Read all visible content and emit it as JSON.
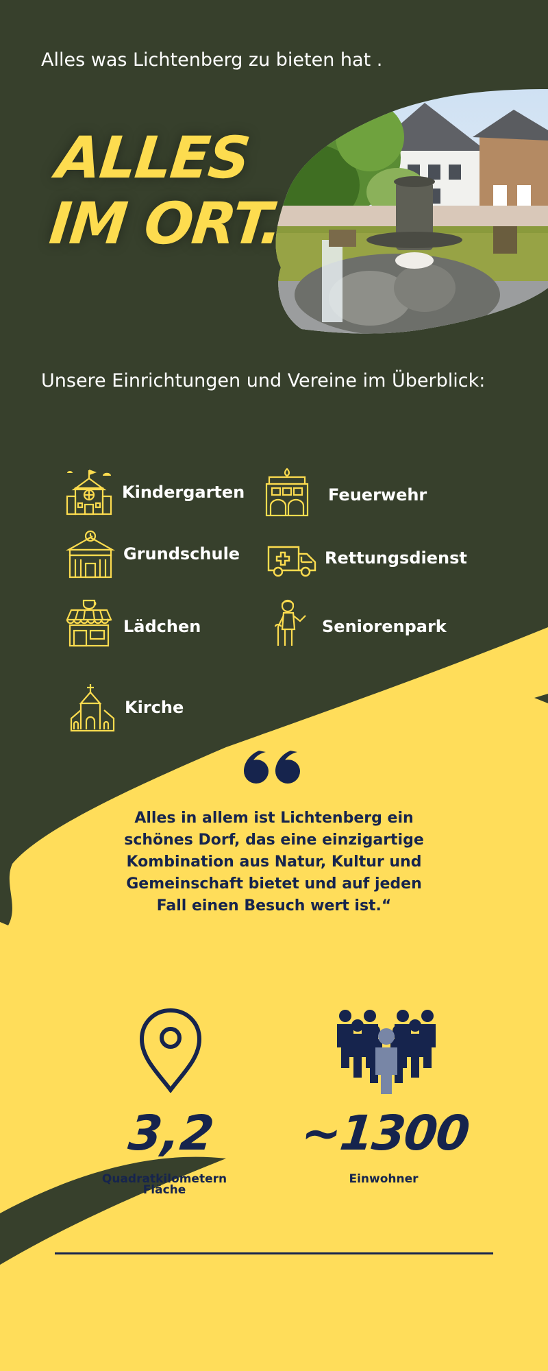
{
  "header": {
    "subtitle": "Alles was Lichtenberg zu bieten hat .",
    "headline_line1": "ALLES",
    "headline_line2": "IM ORT..."
  },
  "overview_title": "Unsere Einrichtungen und Vereine im Überblick:",
  "facilities": [
    {
      "label": "Kindergarten",
      "icon": "kindergarten-icon"
    },
    {
      "label": "Feuerwehr",
      "icon": "fire-station-icon"
    },
    {
      "label": "Grundschule",
      "icon": "school-icon"
    },
    {
      "label": "Rettungsdienst",
      "icon": "ambulance-icon"
    },
    {
      "label": "Lädchen",
      "icon": "shop-icon"
    },
    {
      "label": "Seniorenpark",
      "icon": "senior-icon"
    },
    {
      "label": "Kirche",
      "icon": "church-icon"
    }
  ],
  "quote": {
    "text": "Alles in allem ist Lichtenberg ein schönes Dorf, das eine einzigartige Kombination aus Natur, Kultur und Gemeinschaft bietet und auf jeden Fall einen Besuch wert ist.“"
  },
  "stats": {
    "area": {
      "value": "3,2",
      "label_line1": "Quadratkilometern",
      "label_line2": "Fläche",
      "icon": "location-pin-icon"
    },
    "population": {
      "value": "~1300",
      "label": "Einwohner",
      "icon": "people-group-icon"
    }
  },
  "colors": {
    "dark_green": "#37402c",
    "yellow": "#ffdd5a",
    "navy": "#16244d",
    "icon_yellow": "#fddc4f"
  }
}
